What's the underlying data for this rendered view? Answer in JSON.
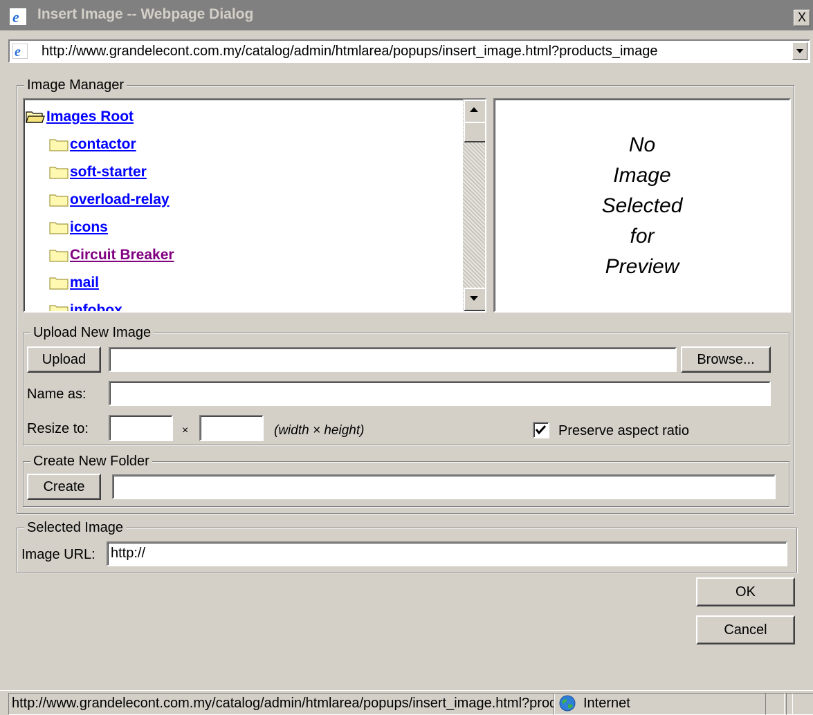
{
  "window": {
    "title": "Insert Image -- Webpage Dialog",
    "close_label": "X",
    "address": "http://www.grandelecont.com.my/catalog/admin/htmlarea/popups/insert_image.html?products_image"
  },
  "image_manager": {
    "legend": "Image Manager",
    "tree": {
      "root": "Images Root",
      "folders": [
        {
          "label": "contactor",
          "visited": false
        },
        {
          "label": "soft-starter",
          "visited": false
        },
        {
          "label": "overload-relay",
          "visited": false
        },
        {
          "label": "icons",
          "visited": false
        },
        {
          "label": "Circuit Breaker",
          "visited": true
        },
        {
          "label": "mail",
          "visited": false
        },
        {
          "label": "infobox",
          "visited": false
        }
      ]
    },
    "preview_lines": [
      "No",
      "Image",
      "Selected",
      "for",
      "Preview"
    ]
  },
  "upload": {
    "legend": "Upload New Image",
    "upload_button": "Upload",
    "file_value": "",
    "browse_button": "Browse...",
    "name_as_label": "Name as:",
    "name_as_value": "",
    "resize_label": "Resize to:",
    "width_value": "",
    "times": "×",
    "height_value": "",
    "dims_hint": "(width × height)",
    "preserve_label": "Preserve aspect ratio",
    "preserve_checked": true
  },
  "create_folder": {
    "legend": "Create New Folder",
    "create_button": "Create",
    "folder_value": ""
  },
  "selected_image": {
    "legend": "Selected Image",
    "url_label": "Image URL:",
    "url_value": "http://"
  },
  "buttons": {
    "ok": "OK",
    "cancel": "Cancel"
  },
  "status_bar": {
    "url": "http://www.grandelecont.com.my/catalog/admin/htmlarea/popups/insert_image.html?products_image",
    "zone": "Internet"
  },
  "colors": {
    "face": "#d4d0c8",
    "link": "#0000ff",
    "visited_link": "#800080",
    "title_inactive": "#808080"
  }
}
